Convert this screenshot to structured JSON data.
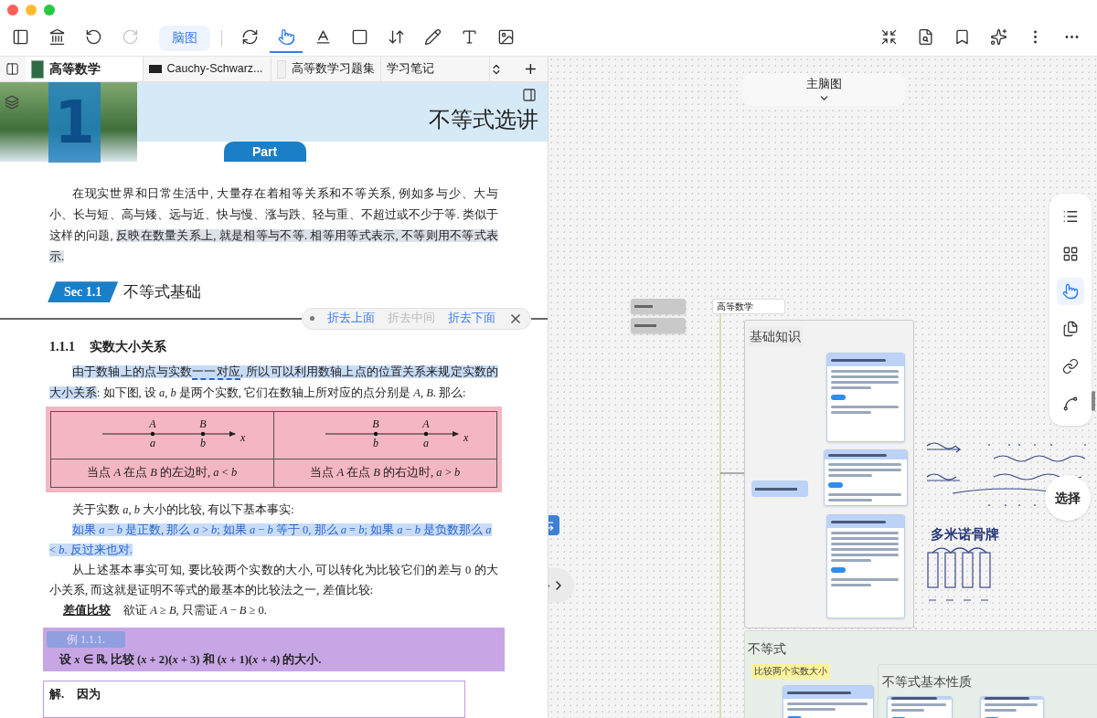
{
  "toolbar": {
    "mode_button": "脑图",
    "left_tools": [
      {
        "kind": "sidebar",
        "selected": false,
        "disabled": false
      },
      {
        "kind": "library",
        "selected": false,
        "disabled": false
      },
      {
        "kind": "undo",
        "selected": false,
        "disabled": false
      },
      {
        "kind": "redo",
        "selected": false,
        "disabled": true
      }
    ],
    "tools": [
      {
        "kind": "sync",
        "selected": false
      },
      {
        "kind": "hand",
        "selected": true
      },
      {
        "kind": "underline",
        "selected": false
      },
      {
        "kind": "frame",
        "selected": false
      },
      {
        "kind": "resize",
        "selected": false
      },
      {
        "kind": "pen",
        "selected": false
      },
      {
        "kind": "textbox",
        "selected": false
      },
      {
        "kind": "image",
        "selected": false
      }
    ],
    "right_tools": [
      {
        "kind": "shrink"
      },
      {
        "kind": "search-doc"
      },
      {
        "kind": "bookmark"
      },
      {
        "kind": "sparkle"
      },
      {
        "kind": "more-vertical"
      },
      {
        "kind": "more-horizontal"
      }
    ]
  },
  "tabs": [
    {
      "label": "高等数学",
      "kind": "book",
      "selected": true
    },
    {
      "label": "Cauchy-Schwarz...",
      "kind": "dark",
      "selected": false
    },
    {
      "label": "高等数学习题集",
      "kind": "page",
      "selected": false
    },
    {
      "label": "学习笔记",
      "kind": "none",
      "selected": false
    }
  ],
  "document": {
    "chapter_number": "1",
    "chapter_title": "不等式选讲",
    "part_label": "Part",
    "intro": [
      {
        "text": "在现实世界和日常生活中, 大量存在着相等关系和不等关系, 例如多与少、大与小、长与短、高与矮、远与近、快与慢、涨与跌、轻与重、不超过或不少于等. 类似于这样的问题, ",
        "kind": "plain"
      },
      {
        "text": "反映在数量关系上, 就是相等与不等. 相等用等式表示, 不等则用不等式表示.",
        "kind": "grey"
      }
    ],
    "section": {
      "badge": "Sec 1.1",
      "title": "不等式基础"
    },
    "fold_options": [
      {
        "label": "折去上面",
        "disabled": false
      },
      {
        "label": "折去中间",
        "disabled": true
      },
      {
        "label": "折去下面",
        "disabled": false
      }
    ],
    "subsection": {
      "number": "1.1.1",
      "title": "实数大小关系"
    },
    "para1": [
      {
        "text": "由于数轴上的点与实数",
        "kind": "blue"
      },
      {
        "text": "一一对应",
        "kind": "dashed"
      },
      {
        "text": ", 所以可以利用数轴上点的位置关系来规定实数的大小关系",
        "kind": "blue"
      },
      {
        "text": ": 如下图, 设 *a*, *b* 是两个实数, 它们在数轴上所对应的点分别是 *A*, *B*. 那么:",
        "kind": "plain"
      }
    ],
    "number_lines": [
      {
        "points": [
          {
            "upper": "A",
            "lower": "a"
          },
          {
            "upper": "B",
            "lower": "b"
          }
        ],
        "axis": "x",
        "caption": "当点 *A* 在点 *B* 的左边时, *a* < *b*"
      },
      {
        "points": [
          {
            "upper": "B",
            "lower": "b"
          },
          {
            "upper": "A",
            "lower": "a"
          }
        ],
        "axis": "x",
        "caption": "当点 *A* 在点 *B* 的右边时, *a* > *b*"
      }
    ],
    "para2": "关于实数 *a*, *b* 大小的比较, 有以下基本事实:",
    "para3": [
      {
        "text": "如果 *a* − *b* 是正数, 那么 *a* > *b*; 如果 *a* − *b* 等于 0, 那么 *a* = *b*; 如果 *a* − *b* 是负数那么 *a* < *b*. 反过来也对.",
        "kind": "blue_text"
      }
    ],
    "para4": "从上述基本事实可知, 要比较两个实数的大小, 可以转化为比较它们的差与 0 的大小关系, 而这就是证明不等式的最基本的比较法之一, 差值比较:",
    "rule": {
      "term": "差值比较",
      "text": "欲证 *A* ≥ *B*, 只需证 *A* − *B* ≥ 0."
    },
    "example": {
      "label": "例 1.1.1.",
      "text": "设 *x* ∈ ℝ, 比较 (*x* + 2)(*x* + 3) 和 (*x* + 1)(*x* + 4) 的大小."
    },
    "solution": {
      "label": "解.",
      "text": "因为"
    }
  },
  "canvas": {
    "map_title": "主脑图",
    "select_button": "选择",
    "root": "高等数学",
    "frames": [
      {
        "title": "基础知识",
        "kind": "grey"
      },
      {
        "title": "不等式",
        "kind": "green"
      },
      {
        "title": "不等式基本性质",
        "kind": "green"
      }
    ],
    "yellow_node": "比较两个实数大小",
    "side_tools": [
      {
        "kind": "list",
        "selected": false
      },
      {
        "kind": "layout",
        "selected": false
      },
      {
        "kind": "hand",
        "selected": true
      },
      {
        "kind": "pages",
        "selected": false
      },
      {
        "kind": "link",
        "selected": false
      },
      {
        "kind": "curve",
        "selected": false
      }
    ],
    "note_title": "多米诺骨牌"
  }
}
